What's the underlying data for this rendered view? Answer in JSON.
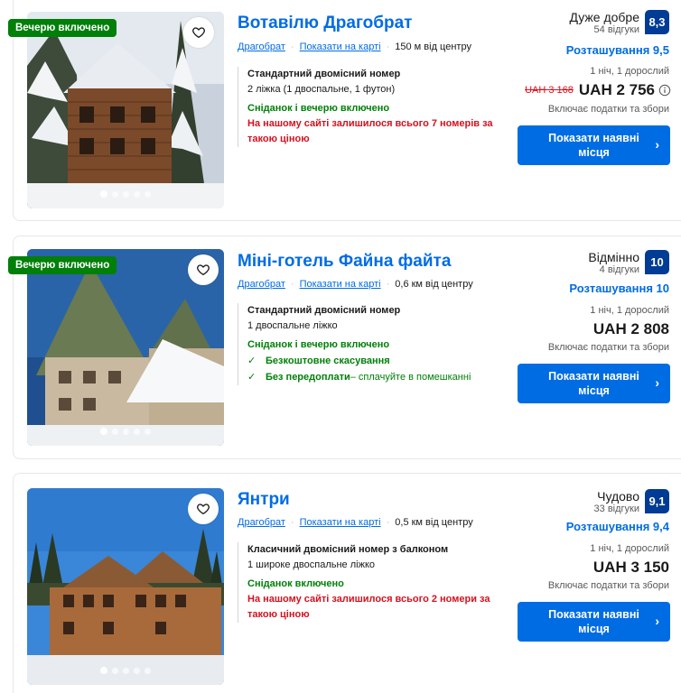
{
  "listings": [
    {
      "badge": "Вечерю включено",
      "title": "Вотавілю Драгобрат",
      "location_link": "Драгобрат",
      "map_link": "Показати на карті",
      "distance": "150 м від центру",
      "room_name": "Стандартний двомісний номер",
      "room_beds": "2 ліжка (1 двоспальне, 1 футон)",
      "meal": "Сніданок і вечерю включено",
      "warning": "На нашому сайті залишилося всього 7 номерів за такою ціною",
      "score_word": "Дуже добре",
      "reviews": "54 відгуки",
      "score": "8,3",
      "location_score": "Розташування 9,5",
      "nights": "1 ніч, 1 дорослий",
      "old_price": "UAH 3 168",
      "price": "UAH 2 756",
      "taxes": "Включає податки та збори",
      "cta": "Показати наявні місця",
      "photo_icon": "chalet-winter-photo"
    },
    {
      "badge": "Вечерю включено",
      "title": "Міні-готель Файна файта",
      "location_link": "Драгобрат",
      "map_link": "Показати на карті",
      "distance": "0,6 км від центру",
      "room_name": "Стандартний двомісний номер",
      "room_beds": "1 двоспальне ліжко",
      "meal": "Сніданок і вечерю включено",
      "free_cancel": "Безкоштовне скасування",
      "no_prepay": "Без передоплати",
      "no_prepay_sub": " – сплачуйте в помешканні",
      "score_word": "Відмінно",
      "reviews": "4 відгуки",
      "score": "10",
      "location_score": "Розташування 10",
      "nights": "1 ніч, 1 дорослий",
      "price": "UAH 2 808",
      "taxes": "Включає податки та збори",
      "cta": "Показати наявні місця",
      "photo_icon": "mini-hotel-photo"
    },
    {
      "title": "Янтри",
      "location_link": "Драгобрат",
      "map_link": "Показати на карті",
      "distance": "0,5 км від центру",
      "room_name": "Класичний двомісний номер з балконом",
      "room_beds": "1 широке двоспальне ліжко",
      "meal": "Сніданок включено",
      "warning": "На нашому сайті залишилося всього 2 номери за такою ціною",
      "score_word": "Чудово",
      "reviews": "33 відгуки",
      "score": "9,1",
      "location_score": "Розташування 9,4",
      "nights": "1 ніч, 1 дорослий",
      "price": "UAH 3 150",
      "taxes": "Включає податки та збори",
      "cta": "Показати наявні місця",
      "photo_icon": "wooden-hotel-photo"
    }
  ],
  "colors": {
    "accent": "#006ce4",
    "score_bg": "#003b95",
    "green": "#008009",
    "red": "#d4111e"
  }
}
